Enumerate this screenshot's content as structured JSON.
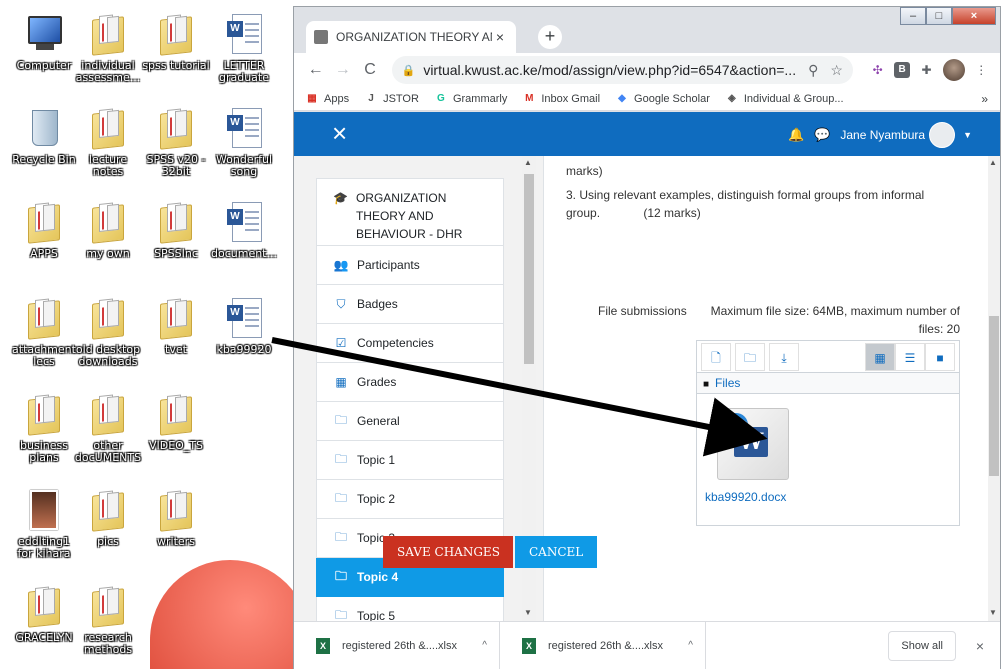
{
  "desktop": {
    "icons": [
      {
        "label": "Computer",
        "icon": "computer-icon"
      },
      {
        "label": "individual assessme...",
        "icon": "folder-icon"
      },
      {
        "label": "spss tutorial",
        "icon": "folder-icon"
      },
      {
        "label": "LETTER graduate",
        "icon": "word-document-icon"
      },
      {
        "label": "Recycle Bin",
        "icon": "recycle-bin-icon"
      },
      {
        "label": "lecture notes",
        "icon": "folder-icon"
      },
      {
        "label": "SPSS v20 - 32bit",
        "icon": "folder-icon"
      },
      {
        "label": "Wonderful song",
        "icon": "word-document-icon"
      },
      {
        "label": "APPS",
        "icon": "folder-icon"
      },
      {
        "label": "my own",
        "icon": "folder-icon"
      },
      {
        "label": "SPSSInc",
        "icon": "folder-icon"
      },
      {
        "label": "document...",
        "icon": "word-document-icon"
      },
      {
        "label": "attachment lecs",
        "icon": "folder-icon"
      },
      {
        "label": "old desktop downloads",
        "icon": "folder-icon"
      },
      {
        "label": "tvet",
        "icon": "folder-icon"
      },
      {
        "label": "kba99920",
        "icon": "word-document-icon"
      },
      {
        "label": "business plans",
        "icon": "folder-icon"
      },
      {
        "label": "other docUMENTS",
        "icon": "folder-icon"
      },
      {
        "label": "VIDEO_TS",
        "icon": "folder-icon"
      },
      {
        "label": "eddlting1 for kihara",
        "icon": "photo-icon"
      },
      {
        "label": "pics",
        "icon": "folder-icon"
      },
      {
        "label": "writers",
        "icon": "folder-icon"
      },
      {
        "label": "GRACELYN",
        "icon": "folder-icon"
      },
      {
        "label": "research methods",
        "icon": "folder-icon"
      }
    ]
  },
  "browser": {
    "tab_title": "ORGANIZATION THEORY AND BE",
    "tab_close": "×",
    "new_tab": "+",
    "window_buttons": [
      "–",
      "□",
      "×"
    ],
    "nav": {
      "back": "←",
      "forward": "→",
      "reload": "C"
    },
    "url": "virtual.kwust.ac.ke/mod/assign/view.php?id=6547&action=...",
    "omnibox_icons": {
      "zoom": "⚲",
      "star": "☆"
    },
    "extensions": [
      "✣",
      "B",
      "✚"
    ],
    "menu": "⋮",
    "bookmarks": [
      {
        "label": "Apps",
        "icon": "apps-grid-icon",
        "glyph": "▦",
        "color": "#d93025"
      },
      {
        "label": "JSTOR",
        "icon": "jstor-icon",
        "glyph": "J",
        "color": "#555555"
      },
      {
        "label": "Grammarly",
        "icon": "grammarly-icon",
        "glyph": "G",
        "color": "#15c39a"
      },
      {
        "label": "Inbox Gmail",
        "icon": "gmail-icon",
        "glyph": "M",
        "color": "#d93025"
      },
      {
        "label": "Google Scholar",
        "icon": "google-scholar-icon",
        "glyph": "◆",
        "color": "#4285f4"
      },
      {
        "label": "Individual & Group...",
        "icon": "site-icon",
        "glyph": "◈",
        "color": "#555555"
      }
    ],
    "bookmarks_more": "»"
  },
  "moodle": {
    "header": {
      "close_menu": "×",
      "notifications_icon": "🔔",
      "messages_icon": "💬",
      "user_name": "Jane Nyambura",
      "user_caret": "▼"
    },
    "drawer": {
      "items": [
        {
          "label": "ORGANIZATION THEORY AND BEHAVIOUR - DHR",
          "icon": "graduation-cap-icon",
          "glyph": "🎓",
          "course": true
        },
        {
          "label": "Participants",
          "icon": "users-icon",
          "glyph": "👥"
        },
        {
          "label": "Badges",
          "icon": "shield-icon",
          "glyph": "⛉"
        },
        {
          "label": "Competencies",
          "icon": "checkbox-icon",
          "glyph": "☑"
        },
        {
          "label": "Grades",
          "icon": "table-icon",
          "glyph": "▦"
        },
        {
          "label": "General",
          "icon": "folder-icon",
          "glyph": "🗀"
        },
        {
          "label": "Topic 1",
          "icon": "folder-icon",
          "glyph": "🗀"
        },
        {
          "label": "Topic 2",
          "icon": "folder-icon",
          "glyph": "🗀"
        },
        {
          "label": "Topic 3",
          "icon": "folder-icon",
          "glyph": "🗀"
        },
        {
          "label": "Topic 4",
          "icon": "folder-icon",
          "glyph": "🗀",
          "active": true
        },
        {
          "label": "Topic 5",
          "icon": "folder-icon",
          "glyph": "🗀"
        }
      ]
    },
    "content": {
      "intro_line1": "marks)",
      "question": "3. Using relevant examples, distinguish formal groups from informal group.",
      "question_marks": "(12 marks)",
      "file_submissions_label": "File submissions",
      "limits": "Maximum file size: 64MB, maximum number of files: 20",
      "toolbar": {
        "add_file": "🗋",
        "create_folder": "🗀",
        "download": "⤓",
        "view_icons": "▦",
        "view_list": "☰",
        "view_tree": "■"
      },
      "path_folder": "■",
      "path_label": "Files",
      "file": {
        "name": "kba99920.docx",
        "badge": "W"
      },
      "save_label": "SAVE CHANGES",
      "cancel_label": "CANCEL"
    }
  },
  "downloads": {
    "items": [
      {
        "name": "registered 26th &....xlsx",
        "badge": "X"
      },
      {
        "name": "registered 26th &....xlsx",
        "badge": "X"
      }
    ],
    "caret": "^",
    "show_all": "Show all",
    "close": "×"
  }
}
